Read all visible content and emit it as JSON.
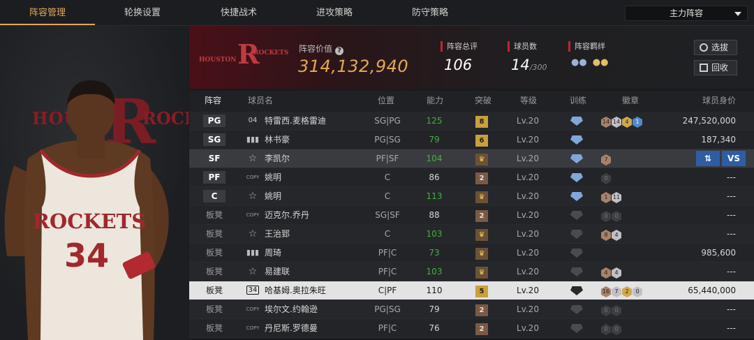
{
  "nav": {
    "tabs": [
      {
        "label": "阵容管理",
        "active": true
      },
      {
        "label": "轮换设置",
        "active": false
      },
      {
        "label": "快捷战术",
        "active": false
      },
      {
        "label": "进攻策略",
        "active": false
      },
      {
        "label": "防守策略",
        "active": false
      }
    ],
    "lineup_select": "主力阵容"
  },
  "player_art": {
    "number": "34",
    "jersey_text": "ROCKETS",
    "bg_left": "HOUS",
    "bg_right": "ROCK"
  },
  "team": {
    "logo_text_left": "HOUSTON",
    "logo_text_right": "ROCKETS",
    "value_label": "阵容价值",
    "value": "314,132,940",
    "rating_label": "阵容总评",
    "rating": "106",
    "players_label": "球员数",
    "players": "14",
    "players_max": "/300",
    "bond_label": "阵容羁绊",
    "draft_button": "选拔",
    "recycle_button": "回收"
  },
  "colors": {
    "accent": "#e0a85a",
    "team_red": "#8a1c25",
    "green": "#3fb23f",
    "gold_value": "#e4a854",
    "vs_blue": "#2f5da3"
  },
  "table": {
    "headers": [
      "阵容",
      "球员名",
      "位置",
      "能力",
      "突破",
      "等级",
      "训练",
      "徽章",
      "球员身价"
    ],
    "rows": [
      {
        "slot": "PG",
        "bench": false,
        "card": "04",
        "name": "特雷西.麦格雷迪",
        "pos": "SG|PG",
        "ovr": "125",
        "green": true,
        "brk": "8",
        "brk_style": "gold",
        "lvl": "Lv.20",
        "train": "star-blue",
        "badges": [
          [
            "b-br",
            "14"
          ],
          [
            "b-sv",
            "14"
          ],
          [
            "b-gd",
            "4"
          ],
          [
            "b-bl",
            "1"
          ]
        ],
        "value": "247,520,000"
      },
      {
        "slot": "SG",
        "bench": false,
        "card": "bars",
        "name": "林书豪",
        "pos": "PG|SG",
        "ovr": "79",
        "green": true,
        "brk": "6",
        "brk_style": "gold",
        "lvl": "Lv.20",
        "train": "1-blue",
        "badges": [],
        "value": "187,340"
      },
      {
        "slot": "SF",
        "bench": false,
        "card": "star",
        "name": "李凯尔",
        "pos": "PF|SF",
        "ovr": "104",
        "green": true,
        "brk": "♛",
        "brk_style": "crown",
        "lvl": "Lv.20",
        "train": "star-blue",
        "badges": [
          [
            "b-br",
            "7"
          ]
        ],
        "value": "",
        "swap": true
      },
      {
        "slot": "PF",
        "bench": false,
        "card": "copy",
        "name": "姚明",
        "pos": "C",
        "ovr": "86",
        "green": false,
        "brk": "2",
        "brk_style": "brown",
        "lvl": "Lv.20",
        "train": "star-blue",
        "badges": [
          [
            "b-dk",
            "0"
          ]
        ],
        "value": "---"
      },
      {
        "slot": "C",
        "bench": false,
        "card": "star",
        "name": "姚明",
        "pos": "C",
        "ovr": "113",
        "green": true,
        "brk": "♛",
        "brk_style": "crown",
        "lvl": "Lv.20",
        "train": "star-blue",
        "badges": [
          [
            "b-br",
            "1"
          ],
          [
            "b-sv",
            "11"
          ]
        ],
        "value": "---"
      },
      {
        "slot": "板凳",
        "bench": true,
        "card": "copy",
        "name": "迈克尔.乔丹",
        "pos": "SG|SF",
        "ovr": "88",
        "green": false,
        "brk": "2",
        "brk_style": "brown",
        "lvl": "Lv.20",
        "train": "dark",
        "badges": [
          [
            "b-dk",
            "0"
          ],
          [
            "b-dk",
            "0"
          ]
        ],
        "value": "---"
      },
      {
        "slot": "板凳",
        "bench": true,
        "card": "star",
        "name": "王治郅",
        "pos": "C",
        "ovr": "103",
        "green": true,
        "brk": "♛",
        "brk_style": "crown",
        "lvl": "Lv.20",
        "train": "dark",
        "badges": [
          [
            "b-br",
            "8"
          ],
          [
            "b-sv",
            "4"
          ]
        ],
        "value": "---"
      },
      {
        "slot": "板凳",
        "bench": true,
        "card": "bars",
        "name": "周琦",
        "pos": "PF|C",
        "ovr": "73",
        "green": true,
        "brk": "♛",
        "brk_style": "crown",
        "lvl": "Lv.20",
        "train": "dark",
        "badges": [],
        "value": "985,600"
      },
      {
        "slot": "板凳",
        "bench": true,
        "card": "star",
        "name": "易建联",
        "pos": "PF|C",
        "ovr": "103",
        "green": true,
        "brk": "♛",
        "brk_style": "crown",
        "lvl": "Lv.20",
        "train": "dark",
        "badges": [
          [
            "b-br",
            "4"
          ],
          [
            "b-sv",
            "4"
          ]
        ],
        "value": "---"
      },
      {
        "slot": "板凳",
        "bench": true,
        "card": "34",
        "name": "哈基姆.奥拉朱旺",
        "pos": "C|PF",
        "ovr": "110",
        "green": false,
        "brk": "5",
        "brk_style": "gold",
        "lvl": "Lv.20",
        "train": "black",
        "badges": [
          [
            "b-br",
            "16"
          ],
          [
            "b-sv",
            "7"
          ],
          [
            "b-gd",
            "2"
          ],
          [
            "b-sv",
            "0"
          ]
        ],
        "value": "65,440,000",
        "selected": true
      },
      {
        "slot": "板凳",
        "bench": true,
        "card": "copy",
        "name": "埃尔文.约翰逊",
        "pos": "PG|SG",
        "ovr": "79",
        "green": false,
        "brk": "2",
        "brk_style": "brown",
        "lvl": "Lv.20",
        "train": "dark",
        "badges": [
          [
            "b-dk",
            "0"
          ],
          [
            "b-dk",
            "0"
          ]
        ],
        "value": "---"
      },
      {
        "slot": "板凳",
        "bench": true,
        "card": "copy",
        "name": "丹尼斯.罗德曼",
        "pos": "PF|C",
        "ovr": "76",
        "green": false,
        "brk": "2",
        "brk_style": "brown",
        "lvl": "Lv.20",
        "train": "dark",
        "badges": [
          [
            "b-dk",
            "0"
          ],
          [
            "b-dk",
            "0"
          ]
        ],
        "value": "---"
      }
    ],
    "swap_labels": [
      "⇅",
      "VS"
    ]
  }
}
